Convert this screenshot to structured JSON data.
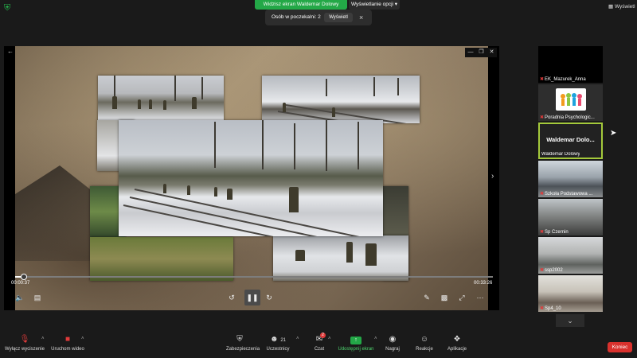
{
  "top": {
    "share_banner": "Widzisz ekran Waldemar Dolowy",
    "view_options": "Wyświetlanie opcji",
    "view": "Wyświetl"
  },
  "waiting": {
    "text": "Osób w poczekalni: 2",
    "view_btn": "Wyświetl",
    "close": "×"
  },
  "player": {
    "current_time": "00:00:37",
    "total_time": "00:33:26",
    "progress": 0.018
  },
  "gallery": [
    {
      "name": "EK_Mazurek_Anna",
      "muted": true
    },
    {
      "name": "Poradnia Psychologic...",
      "muted": true
    },
    {
      "name": "Waldemar Dolowy",
      "big_name": "Waldemar  Dolo...",
      "muted": false
    },
    {
      "name": "Szkoła Podstawowa ...",
      "muted": true
    },
    {
      "name": "Sp Czernin",
      "muted": true
    },
    {
      "name": "ssp2002",
      "muted": true
    },
    {
      "name": "Sp4_10",
      "muted": true
    }
  ],
  "toolbar": {
    "mute": "Wyłącz wyciszenie",
    "video": "Uruchom wideo",
    "security": "Zabezpieczenia",
    "participants": "Uczestnicy",
    "participants_count": "21",
    "chat": "Czat",
    "chat_badge": "2",
    "share": "Udostępnij ekran",
    "record": "Nagraj",
    "reactions": "Reakcje",
    "apps": "Aplikacje",
    "leave": "Koniec"
  },
  "icons": {
    "shield": "shield-icon",
    "mic": "mic-off-icon",
    "camera": "camera-off-icon",
    "security": "security-icon",
    "participants": "people-icon",
    "chat": "chat-icon",
    "share": "share-screen-icon",
    "record": "record-icon",
    "reactions": "emoji-icon",
    "apps": "apps-icon"
  },
  "colors": {
    "accent_green": "#23a847",
    "active_speaker": "#a4c93b",
    "leave_red": "#d9312d"
  }
}
